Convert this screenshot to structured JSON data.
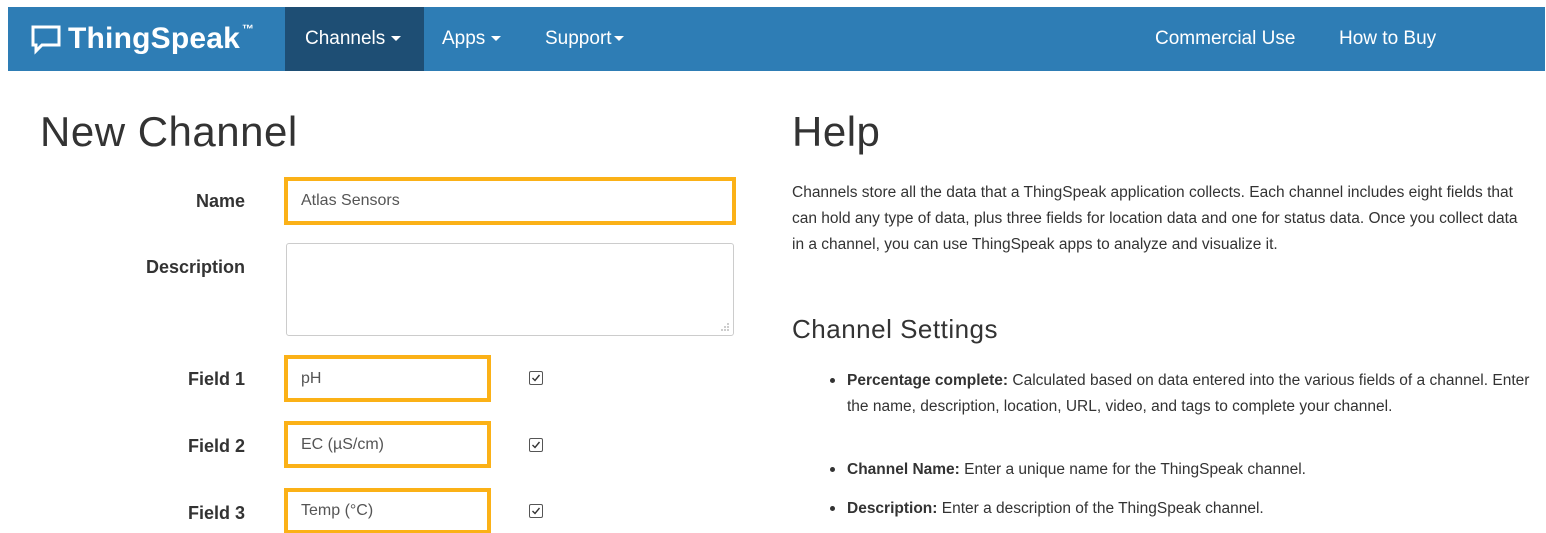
{
  "navbar": {
    "brand": "ThingSpeak",
    "brand_tm": "™",
    "brand_icon": "speech-bubble-icon",
    "items": [
      {
        "label": "Channels",
        "active": true
      },
      {
        "label": "Apps"
      },
      {
        "label": "Support"
      }
    ],
    "right_items": [
      {
        "label": "Commercial Use"
      },
      {
        "label": "How to Buy"
      }
    ],
    "color": "#2e7db5",
    "active_color": "#1e4e74"
  },
  "page_title": "New Channel",
  "form": {
    "name_label": "Name",
    "name_value": "Atlas Sensors",
    "description_label": "Description",
    "description_value": "",
    "highlight_color": "#fbb117",
    "fields": [
      {
        "label": "Field 1",
        "value": "pH",
        "enabled": true
      },
      {
        "label": "Field 2",
        "value": "EC (µS/cm)",
        "enabled": true
      },
      {
        "label": "Field 3",
        "value": "Temp (°C)",
        "enabled": true
      }
    ]
  },
  "help": {
    "title": "Help",
    "intro": "Channels store all the data that a ThingSpeak application collects. Each channel includes eight fields that can hold any type of data, plus three fields for location data and one for status data. Once you collect data in a channel, you can use ThingSpeak apps to analyze and visualize it.",
    "settings_title": "Channel Settings",
    "bullets": [
      {
        "term": "Percentage complete:",
        "text": " Calculated based on data entered into the various fields of a channel. Enter the name, description, location, URL, video, and tags to complete your channel."
      },
      {
        "term": "Channel Name:",
        "text": " Enter a unique name for the ThingSpeak channel."
      },
      {
        "term": "Description:",
        "text": " Enter a description of the ThingSpeak channel."
      }
    ]
  }
}
